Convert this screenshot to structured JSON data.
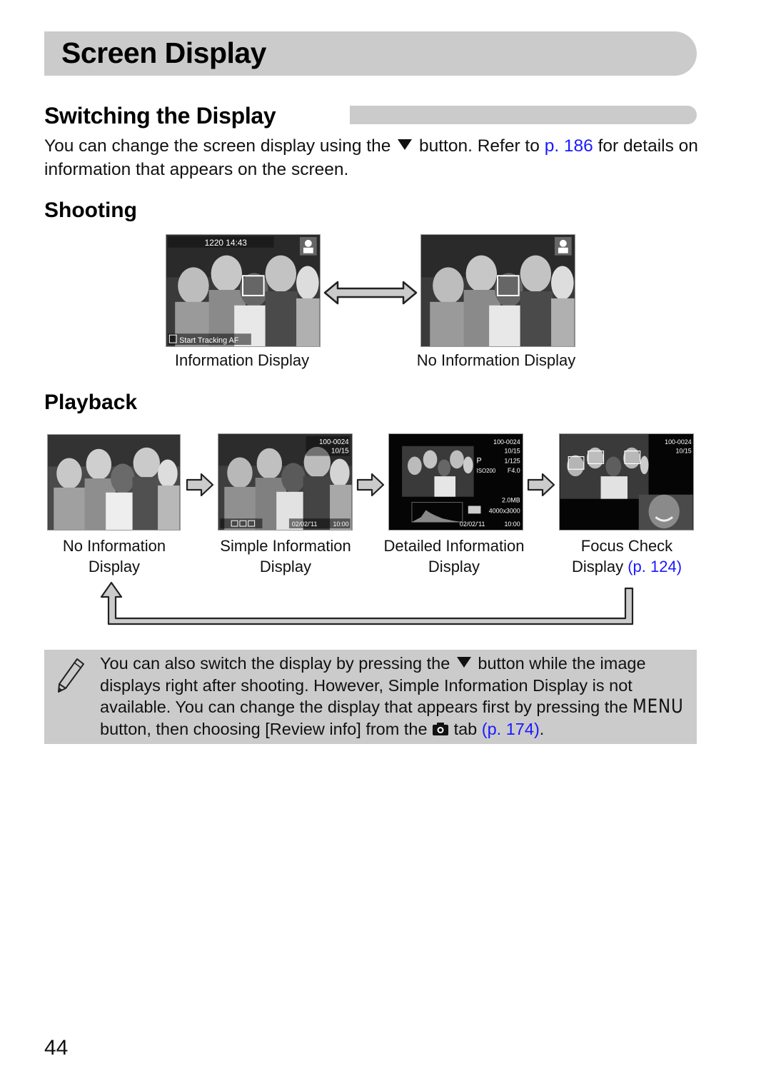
{
  "header": {
    "title": "Screen Display"
  },
  "section": {
    "heading": "Switching the Display",
    "intro_part1": "You can change the screen display using the",
    "intro_part2": "button. Refer to",
    "intro_link": "p. 186",
    "intro_part3": "for details on information that appears on the screen.",
    "button_icon": "down-triangle-icon"
  },
  "shooting": {
    "heading": "Shooting",
    "screens": [
      {
        "caption": "Information Display",
        "overlay_top": "1220  14:43",
        "overlay_bottom": "Start Tracking AF"
      },
      {
        "caption": "No Information Display"
      }
    ],
    "arrow": "double-arrow-icon"
  },
  "playback": {
    "heading": "Playback",
    "screens": [
      {
        "caption_line1": "No Information",
        "caption_line2": "Display"
      },
      {
        "caption_line1": "Simple Information",
        "caption_line2": "Display",
        "overlay_file": "100-0024",
        "overlay_count": "10/15",
        "overlay_date": "02/02/'11",
        "overlay_time": "10:00"
      },
      {
        "caption_line1": "Detailed Information",
        "caption_line2": "Display",
        "overlay_file": "100-0024",
        "overlay_count": "10/15",
        "overlay_mode": "P",
        "overlay_shutter": "1/125",
        "overlay_iso": "ISO200",
        "overlay_aperture": "F4.0",
        "overlay_size": "2.0MB",
        "overlay_res": "4000x3000",
        "overlay_date": "02/02/'11",
        "overlay_time": "10:00"
      },
      {
        "caption_line1": "Focus Check",
        "caption_line2": "Display",
        "caption_link": "(p. 124)",
        "overlay_file": "100-0024",
        "overlay_count": "10/15"
      }
    ]
  },
  "note": {
    "icon": "pencil-icon",
    "line1_a": "You can also switch the display by pressing the",
    "line1_b": "button while the image displays right after shooting. However, Simple Information Display is not available. You can change the display that appears first by pressing the",
    "menu_label": "MENU",
    "line2_a": "button, then choosing [Review info] from the",
    "line2_b": "tab",
    "link": "(p. 174)",
    "end": "."
  },
  "footer": {
    "page_number": "44"
  },
  "colors": {
    "gray_bar": "#cbcbcb",
    "link": "#1a1aff"
  }
}
